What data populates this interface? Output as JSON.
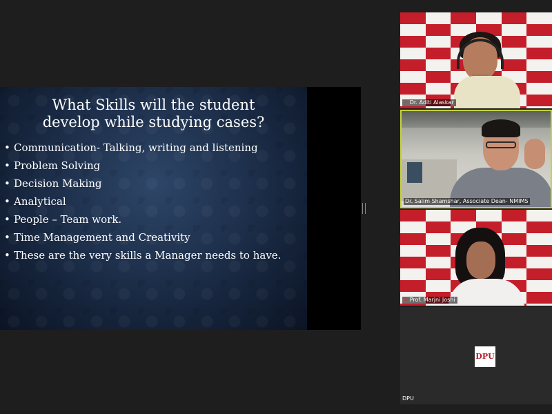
{
  "slide": {
    "title_line1": "What Skills will the student",
    "title_line2": "develop while studying cases?",
    "bullet_symbol": "•",
    "bullets": [
      "Communication- Talking, writing and listening",
      "Problem Solving",
      "Decision Making",
      "Analytical",
      "People – Team work.",
      "Time Management and Creativity",
      "These are the very skills a Manager needs to have."
    ]
  },
  "participants": [
    {
      "name": "Dr. Aditi Alaskar",
      "muted": true
    },
    {
      "name": "Dr. Salim Shamshar, Associate Dean- NMIMS",
      "muted": false,
      "active_speaker": true
    },
    {
      "name": "Prof. Marjni Joshi",
      "muted": true
    },
    {
      "name": "DPU",
      "logo_text": "DPU"
    }
  ],
  "icons": {
    "muted_mic": "muted-mic-icon"
  },
  "colors": {
    "background": "#1e1e1e",
    "active_speaker_border": "#c4d43a",
    "backdrop_red": "#c41e2a",
    "slide_blue": "#1d2f4b",
    "muted_red": "#e03434"
  }
}
